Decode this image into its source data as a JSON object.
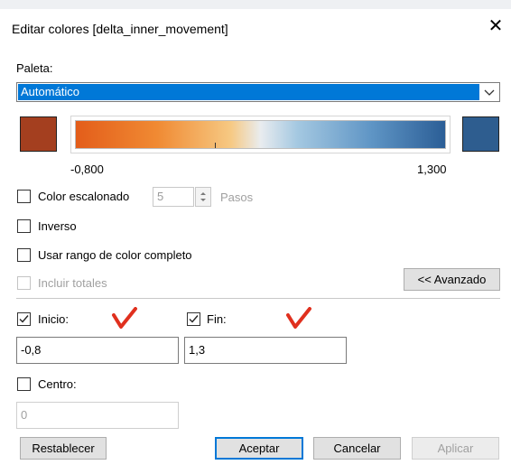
{
  "dialog": {
    "title": "Editar colores [delta_inner_movement]",
    "close_glyph": "✕"
  },
  "palette": {
    "label": "Paleta:",
    "selected": "Automático",
    "color_start": "#a43f1f",
    "color_end": "#2e5d8f",
    "range_min_label": "-0,800",
    "range_max_label": "1,300"
  },
  "options": {
    "stepped_label": "Color escalonado",
    "steps_value": "5",
    "steps_unit": "Pasos",
    "reverse_label": "Inverso",
    "full_range_label": "Usar rango de color completo",
    "include_totals_label": "Incluir totales",
    "advanced_button": "<< Avanzado"
  },
  "advanced": {
    "start_label": "Inicio:",
    "start_checked": true,
    "start_value": "-0,8",
    "end_label": "Fin:",
    "end_checked": true,
    "end_value": "1,3",
    "center_label": "Centro:",
    "center_checked": false,
    "center_value": "0",
    "annotation_color": "#e0301e"
  },
  "footer": {
    "reset": "Restablecer",
    "ok": "Aceptar",
    "cancel": "Cancelar",
    "apply": "Aplicar"
  }
}
